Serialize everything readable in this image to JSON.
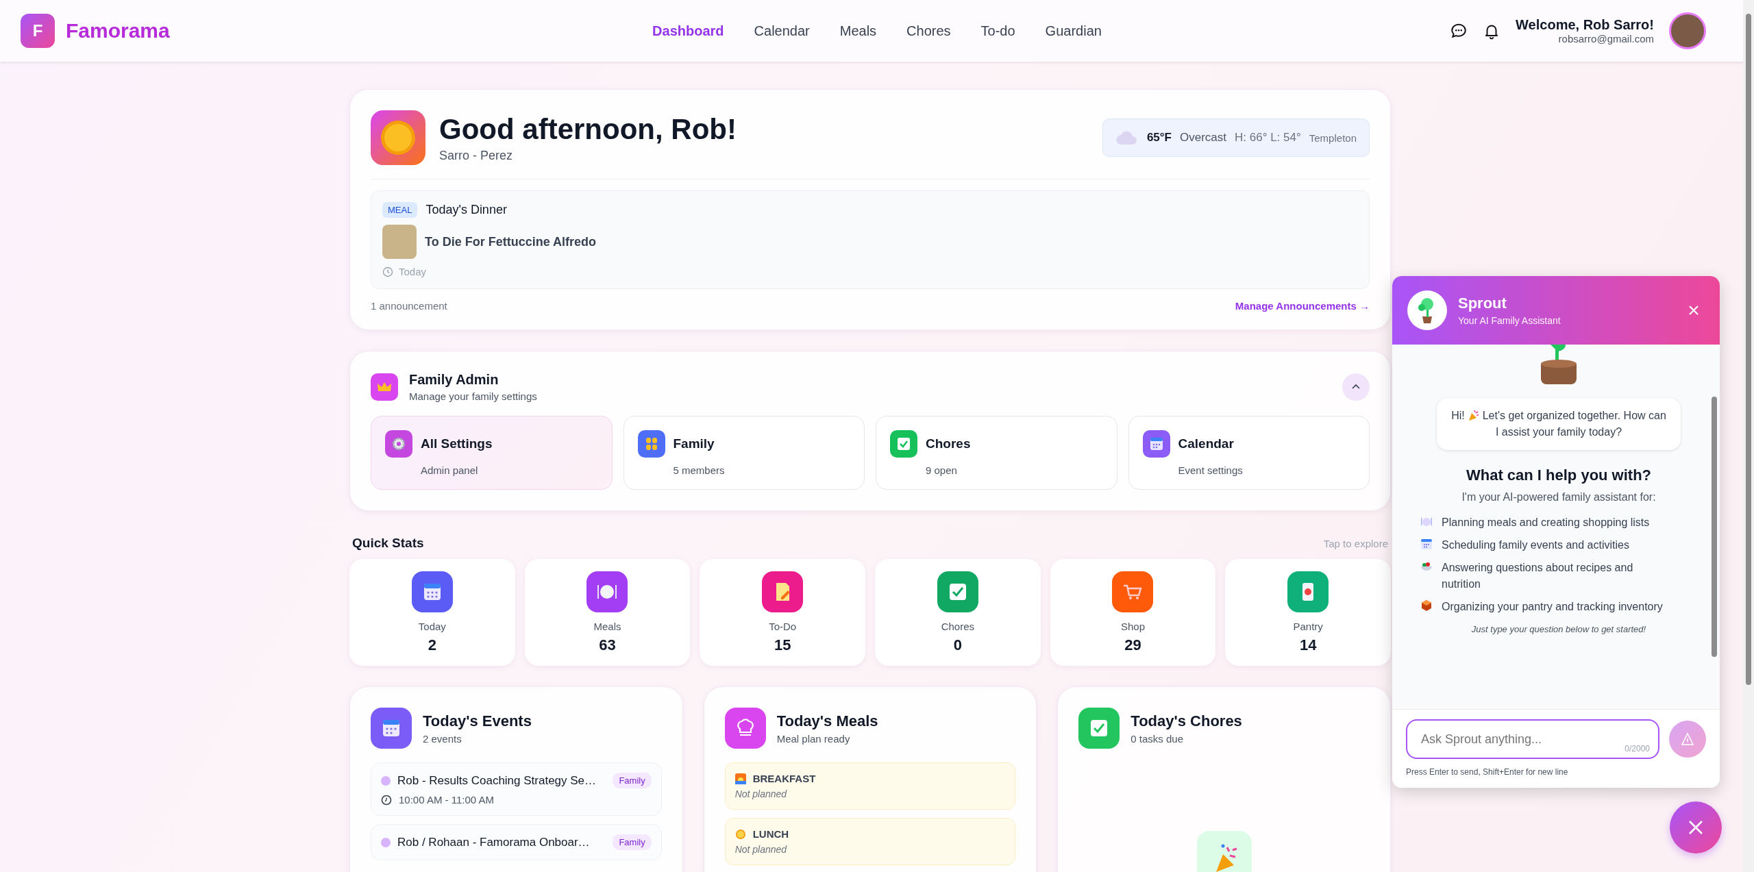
{
  "app": {
    "logo_letter": "F",
    "name": "Famorama"
  },
  "nav": [
    {
      "label": "Dashboard",
      "selected": true
    },
    {
      "label": "Calendar",
      "selected": false
    },
    {
      "label": "Meals",
      "selected": false
    },
    {
      "label": "Chores",
      "selected": false
    },
    {
      "label": "To-do",
      "selected": false
    },
    {
      "label": "Guardian",
      "selected": false
    }
  ],
  "user": {
    "welcome": "Welcome, Rob Sarro!",
    "email": "robsarro@gmail.com"
  },
  "greeting": {
    "title": "Good afternoon, Rob!",
    "subtitle": "Sarro - Perez"
  },
  "weather": {
    "temp": "65°F",
    "condition": "Overcast",
    "range": "H: 66° L: 54°",
    "location": "Templeton"
  },
  "announcement": {
    "tag": "MEAL",
    "title": "Today's Dinner",
    "meal": "To Die For Fettuccine Alfredo",
    "when": "Today"
  },
  "announcement_footer": {
    "count": "1 announcement",
    "link": "Manage Announcements →"
  },
  "family_admin": {
    "title": "Family Admin",
    "subtitle": "Manage your family settings",
    "expanded": true,
    "tiles": [
      {
        "kind": "gear",
        "title": "All Settings",
        "subtitle": "Admin panel",
        "selected": true,
        "color": "#c448e0"
      },
      {
        "kind": "people",
        "title": "Family",
        "subtitle": "5 members",
        "selected": false,
        "color": "#4f6ef7"
      },
      {
        "kind": "check",
        "title": "Chores",
        "subtitle": "9 open",
        "selected": false,
        "color": "#16c15b"
      },
      {
        "kind": "calendar",
        "title": "Calendar",
        "subtitle": "Event settings",
        "selected": false,
        "color": "#8b5cf6"
      }
    ]
  },
  "quick_stats": {
    "title": "Quick Stats",
    "hint": "Tap to explore",
    "items": [
      {
        "kind": "calendar",
        "label": "Today",
        "value": "2",
        "color": "#5b5cf6"
      },
      {
        "kind": "plate",
        "label": "Meals",
        "value": "63",
        "color": "#a43ef5"
      },
      {
        "kind": "note",
        "label": "To-Do",
        "value": "15",
        "color": "#ec1c8c"
      },
      {
        "kind": "check",
        "label": "Chores",
        "value": "0",
        "color": "#10a862"
      },
      {
        "kind": "cart",
        "label": "Shop",
        "value": "29",
        "color": "#ff5a0a"
      },
      {
        "kind": "can",
        "label": "Pantry",
        "value": "14",
        "color": "#10b07a"
      }
    ]
  },
  "events": {
    "title": "Today's Events",
    "subtitle": "2 events",
    "items": [
      {
        "title": "Rob - Results Coaching Strategy Se…",
        "tag": "Family",
        "time": "10:00 AM - 11:00 AM"
      },
      {
        "title": "Rob / Rohaan - Famorama Onboar…",
        "tag": "Family"
      }
    ]
  },
  "meals": {
    "title": "Today's Meals",
    "subtitle": "Meal plan ready",
    "items": [
      {
        "kind": "breakfast",
        "label": "BREAKFAST",
        "status": "Not planned"
      },
      {
        "kind": "lunch",
        "label": "LUNCH",
        "status": "Not planned"
      }
    ]
  },
  "chores": {
    "title": "Today's Chores",
    "subtitle": "0 tasks due"
  },
  "chat": {
    "name": "Sprout",
    "subtitle": "Your AI Family Assistant",
    "bubble_hi": "Hi!",
    "bubble_text": "Let's get organized together. How can I assist your family today?",
    "heading": "What can I help you with?",
    "intro": "I'm your AI-powered family assistant for:",
    "features": [
      {
        "kind": "plate",
        "text": "Planning meals and creating shopping lists"
      },
      {
        "kind": "calendar",
        "text": "Scheduling family events and activities"
      },
      {
        "kind": "salad",
        "text": "Answering questions about recipes and nutrition"
      },
      {
        "kind": "box",
        "text": "Organizing your pantry and tracking inventory"
      }
    ],
    "footer": "Just type your question below to get started!",
    "placeholder": "Ask Sprout anything...",
    "counter": "0/2000",
    "hint": "Press Enter to send, Shift+Enter for new line"
  }
}
